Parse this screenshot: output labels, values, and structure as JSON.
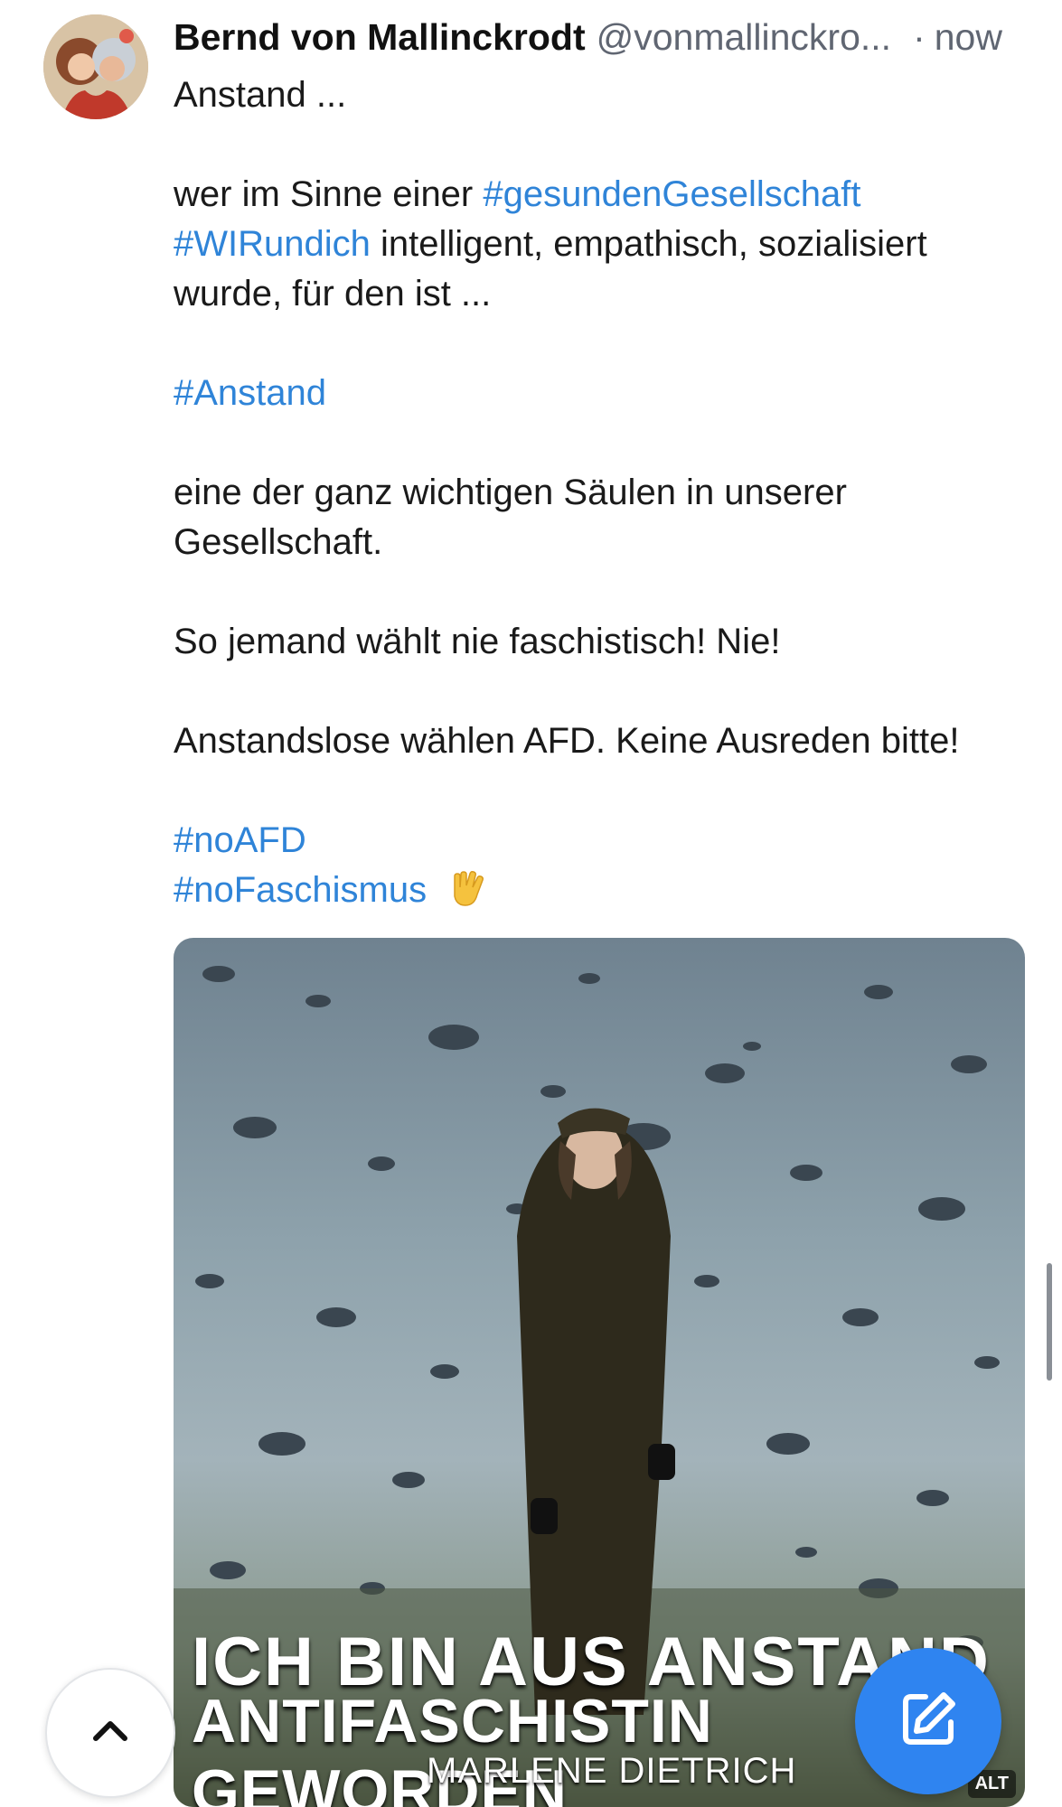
{
  "post": {
    "display_name": "Bernd von Mallinckrodt",
    "handle": "@vonmallinckro...",
    "separator": "·",
    "time": "now",
    "text": {
      "line1": "Anstand ...",
      "line2_prefix": "wer im Sinne einer",
      "tag_gesunde": "#gesundenGesellschaft",
      "tag_wir": "#WIRundich",
      "line3_suffix": "intelligent, empathisch, sozialisiert",
      "line4": "wurde, für den ist ...",
      "tag_anstand": "#Anstand",
      "line5": "eine der ganz wichtigen Säulen in unserer",
      "line6": "Gesellschaft.",
      "line7": "So jemand wählt nie faschistisch! Nie!",
      "line8": "Anstandslose wählen AFD. Keine Ausreden bitte!",
      "tag_noafd": "#noAFD",
      "tag_nofaschismus": "#noFaschismus"
    },
    "emoji_icon": "vulcan-salute-icon",
    "media": {
      "caption_line1": "ICH BIN AUS ANSTAND",
      "caption_line2": "ANTIFASCHISTIN GEWORDEN",
      "caption_line3": "MARLENE DIETRICH",
      "alt_badge": "ALT"
    }
  },
  "controls": {
    "scroll_top_icon": "chevron-up-icon",
    "compose_icon": "compose-icon"
  },
  "colors": {
    "hashtag": "#2f84d8",
    "accent": "#2f84f0",
    "muted": "#606672"
  }
}
